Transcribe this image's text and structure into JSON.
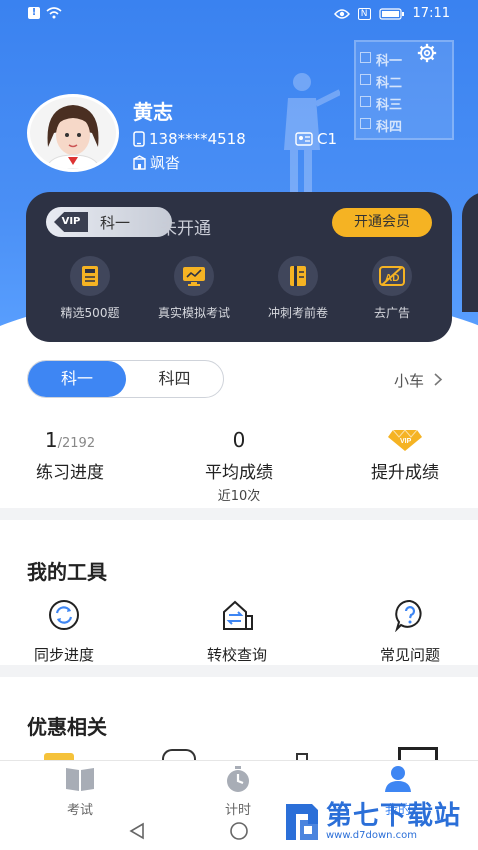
{
  "status_bar": {
    "time": "17:11"
  },
  "deco_subjects": [
    "科一",
    "科二",
    "科三",
    "科四"
  ],
  "profile": {
    "name": "黄志",
    "phone": "138****4518",
    "license_type": "C1",
    "region": "飒沓"
  },
  "vip": {
    "logo_text": "VIP",
    "subject": "科一",
    "status": "未开通",
    "open_button": "开通会员",
    "features": [
      {
        "label": "精选500题",
        "icon": "book-500-icon"
      },
      {
        "label": "真实模拟考试",
        "icon": "monitor-icon"
      },
      {
        "label": "冲刺考前卷",
        "icon": "notebook-icon"
      },
      {
        "label": "去广告",
        "icon": "no-ad-icon"
      }
    ]
  },
  "subject_tabs": {
    "active": "科一",
    "inactive": "科四"
  },
  "vehicle": {
    "label": "小车"
  },
  "stats": {
    "progress_value": "1",
    "progress_total": "/2192",
    "progress_label": "练习进度",
    "avg_value": "0",
    "avg_label": "平均成绩",
    "avg_sub": "近10次",
    "boost_label": "提升成绩"
  },
  "tools": {
    "title": "我的工具",
    "items": [
      {
        "label": "同步进度",
        "icon": "sync-icon"
      },
      {
        "label": "转校查询",
        "icon": "transfer-school-icon"
      },
      {
        "label": "常见问题",
        "icon": "question-icon"
      }
    ]
  },
  "discounts": {
    "title": "优惠相关"
  },
  "tabbar": {
    "items": [
      {
        "label": "考试",
        "icon": "book-icon"
      },
      {
        "label": "计时",
        "icon": "stopwatch-icon"
      },
      {
        "label": "我的",
        "icon": "person-icon"
      }
    ],
    "active_color": "#3e86f3"
  },
  "watermark": {
    "name": "第七下载站",
    "url": "www.d7down.com"
  },
  "colors": {
    "brand_blue": "#3a82f0",
    "vip_gold": "#f5b323",
    "vip_card": "#2d3244"
  }
}
